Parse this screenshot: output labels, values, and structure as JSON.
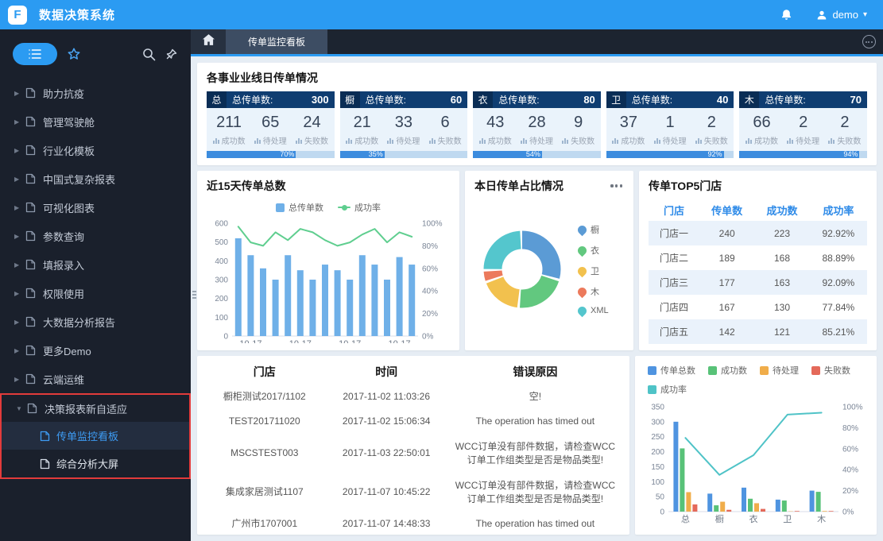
{
  "header": {
    "title": "数据决策系统",
    "user": "demo"
  },
  "sidebar": {
    "items": [
      "助力抗疫",
      "管理驾驶舱",
      "行业化模板",
      "中国式复杂报表",
      "可视化图表",
      "参数查询",
      "填报录入",
      "权限使用",
      "大数据分析报告",
      "更多Demo",
      "云端运维"
    ],
    "group": {
      "label": "决策报表新自适应",
      "children": [
        {
          "label": "传单监控看板",
          "active": true
        },
        {
          "label": "综合分析大屏",
          "active": false
        }
      ]
    }
  },
  "tabs": [
    {
      "label": "传单监控看板"
    }
  ],
  "kpi": {
    "title": "各事业业线日传单情况",
    "total_label": "总传单数:",
    "metric_labels": {
      "success": "成功数",
      "pending": "待处理",
      "failed": "失败数"
    },
    "cards": [
      {
        "tag": "总",
        "total": 300,
        "success": 211,
        "pending": 65,
        "failed": 24,
        "rate": "70%",
        "rate_pct": 70
      },
      {
        "tag": "橱",
        "total": 60,
        "success": 21,
        "pending": 33,
        "failed": 6,
        "rate": "35%",
        "rate_pct": 35
      },
      {
        "tag": "衣",
        "total": 80,
        "success": 43,
        "pending": 28,
        "failed": 9,
        "rate": "54%",
        "rate_pct": 54
      },
      {
        "tag": "卫",
        "total": 40,
        "success": 37,
        "pending": 1,
        "failed": 2,
        "rate": "92%",
        "rate_pct": 92
      },
      {
        "tag": "木",
        "total": 70,
        "success": 66,
        "pending": 2,
        "failed": 2,
        "rate": "94%",
        "rate_pct": 94
      }
    ]
  },
  "top5": {
    "title": "传单TOP5门店",
    "headers": [
      "门店",
      "传单数",
      "成功数",
      "成功率"
    ],
    "rows": [
      [
        "门店一",
        "240",
        "223",
        "92.92%"
      ],
      [
        "门店二",
        "189",
        "168",
        "88.89%"
      ],
      [
        "门店三",
        "177",
        "163",
        "92.09%"
      ],
      [
        "门店四",
        "167",
        "130",
        "77.84%"
      ],
      [
        "门店五",
        "142",
        "121",
        "85.21%"
      ]
    ]
  },
  "error_table": {
    "headers": [
      "门店",
      "时间",
      "错误原因"
    ],
    "rows": [
      [
        "橱柜测试2017/1102",
        "2017-11-02 11:03:26",
        "空!"
      ],
      [
        "TEST201711020",
        "2017-11-02 15:06:34",
        "The operation has timed out"
      ],
      [
        "MSCSTEST003",
        "2017-11-03 22:50:01",
        "WCC订单没有部件数据，请检查WCC订单工作组类型是否是物品类型!"
      ],
      [
        "集成家居测试1107",
        "2017-11-07 10:45:22",
        "WCC订单没有部件数据，请检查WCC订单工作组类型是否是物品类型!"
      ],
      [
        "广州市1707001",
        "2017-11-07 14:48:33",
        "The operation has timed out"
      ]
    ]
  },
  "chart_data": [
    {
      "id": "trend15",
      "type": "bar",
      "title": "近15天传单总数",
      "x_tick_labels": [
        "10-17",
        "10-17",
        "10-17",
        "10-17"
      ],
      "x_tick_positions": [
        1,
        5,
        9,
        13
      ],
      "series": [
        {
          "name": "总传单数",
          "kind": "bar",
          "color": "#6FB0E8",
          "values": [
            520,
            430,
            360,
            300,
            430,
            350,
            300,
            380,
            350,
            300,
            430,
            380,
            300,
            420,
            380
          ]
        },
        {
          "name": "成功率",
          "kind": "line",
          "color": "#5FCE8F",
          "axis": "right",
          "values": [
            97,
            83,
            80,
            92,
            85,
            95,
            92,
            85,
            80,
            83,
            90,
            95,
            83,
            92,
            88
          ]
        }
      ],
      "ylim": [
        0,
        600
      ],
      "y_ticks": [
        "0",
        "100",
        "200",
        "300",
        "400",
        "500",
        "600"
      ],
      "y2lim": [
        0,
        100
      ],
      "y2_ticks": [
        "0%",
        "20%",
        "40%",
        "60%",
        "80%",
        "100%"
      ],
      "legend_position": "top",
      "grid": false
    },
    {
      "id": "dailyShare",
      "type": "pie",
      "title": "本日传单占比情况",
      "labels": [
        "橱",
        "衣",
        "卫",
        "木",
        "XML"
      ],
      "values": [
        30,
        22,
        18,
        5,
        25
      ],
      "colors": [
        "#5B9BD5",
        "#62C87F",
        "#F2C14E",
        "#EC7A5C",
        "#54C6CD"
      ],
      "legend_position": "right"
    },
    {
      "id": "byLine",
      "type": "bar",
      "categories": [
        "总",
        "橱",
        "衣",
        "卫",
        "木"
      ],
      "series": [
        {
          "name": "传单总数",
          "kind": "bar",
          "color": "#4F94E0",
          "values": [
            300,
            60,
            80,
            40,
            70
          ]
        },
        {
          "name": "成功数",
          "kind": "bar",
          "color": "#58C278",
          "values": [
            211,
            21,
            43,
            37,
            66
          ]
        },
        {
          "name": "待处理",
          "kind": "bar",
          "color": "#F0AD4A",
          "values": [
            65,
            33,
            28,
            1,
            2
          ]
        },
        {
          "name": "失败数",
          "kind": "bar",
          "color": "#E4695A",
          "values": [
            24,
            6,
            9,
            2,
            2
          ]
        },
        {
          "name": "成功率",
          "kind": "line",
          "color": "#4FC3C7",
          "axis": "right",
          "values": [
            70.3,
            35,
            53.8,
            92.5,
            94.3
          ]
        }
      ],
      "ylim": [
        0,
        350
      ],
      "y_ticks": [
        "0",
        "50",
        "100",
        "150",
        "200",
        "250",
        "300",
        "350"
      ],
      "y2lim": [
        0,
        100
      ],
      "y2_ticks": [
        "0%",
        "20%",
        "40%",
        "60%",
        "80%",
        "100%"
      ],
      "legend_position": "top",
      "grid": false
    }
  ]
}
